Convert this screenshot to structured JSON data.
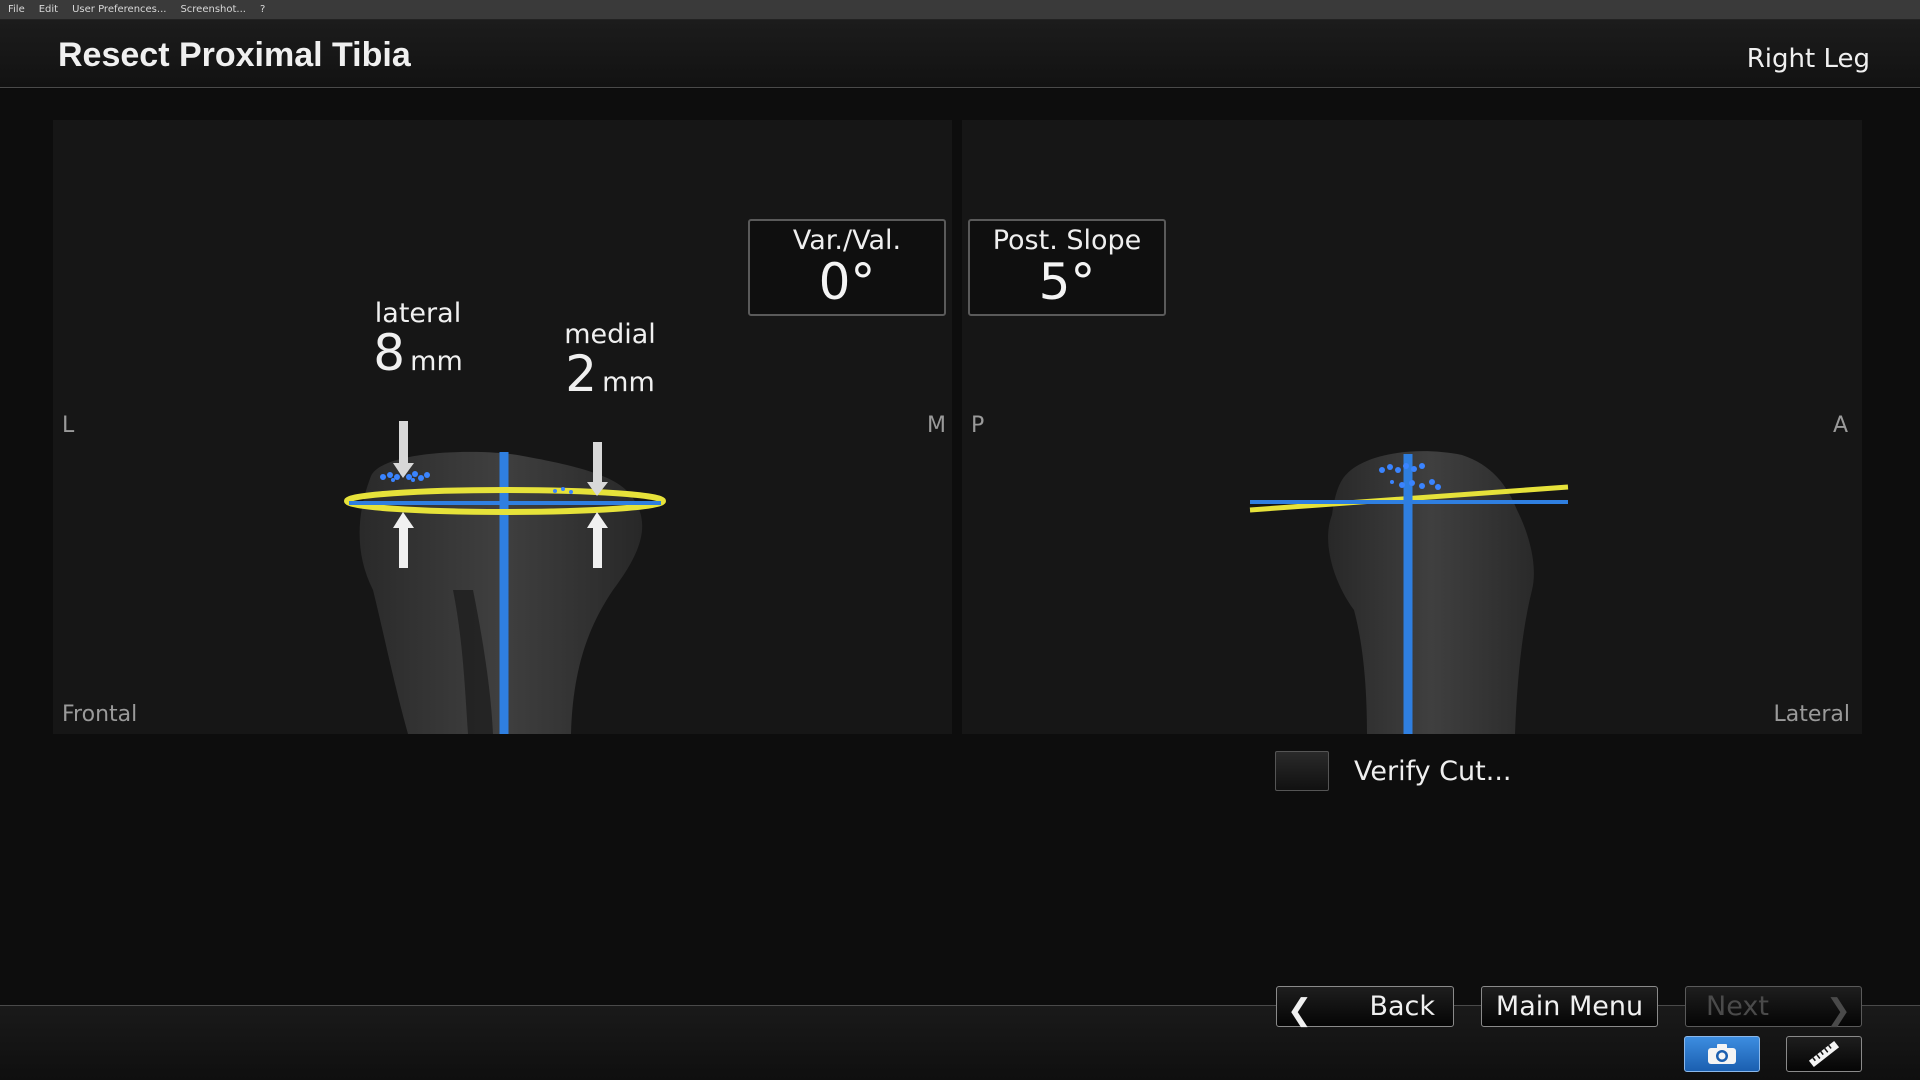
{
  "menu": {
    "items": [
      "File",
      "Edit",
      "User Preferences...",
      "Screenshot...",
      "?"
    ]
  },
  "header": {
    "title": "Resect Proximal Tibia",
    "leg_side": "Right Leg"
  },
  "frontal_view": {
    "label_left": "L",
    "label_right": "M",
    "view_name": "Frontal",
    "lateral_depth": {
      "side": "lateral",
      "value": "8",
      "unit": "mm"
    },
    "medial_depth": {
      "side": "medial",
      "value": "2",
      "unit": "mm"
    }
  },
  "lateral_view": {
    "label_left": "P",
    "label_right": "A",
    "view_name": "Lateral"
  },
  "angles": {
    "varval": {
      "title": "Var./Val.",
      "value": "0°"
    },
    "post_slope": {
      "title": "Post. Slope",
      "value": "5°"
    }
  },
  "verify_cut": {
    "label": "Verify Cut...",
    "checked": false
  },
  "nav": {
    "back_label": "Back",
    "main_menu_label": "Main Menu",
    "next_label": "Next",
    "next_enabled": false
  },
  "tools": {
    "camera_icon": "camera-icon",
    "ruler_icon": "ruler-icon"
  },
  "colors": {
    "accent_blue": "#2f7fe0",
    "plane_yellow": "#e6e23a",
    "bone_gray": "#3a3a3a"
  }
}
